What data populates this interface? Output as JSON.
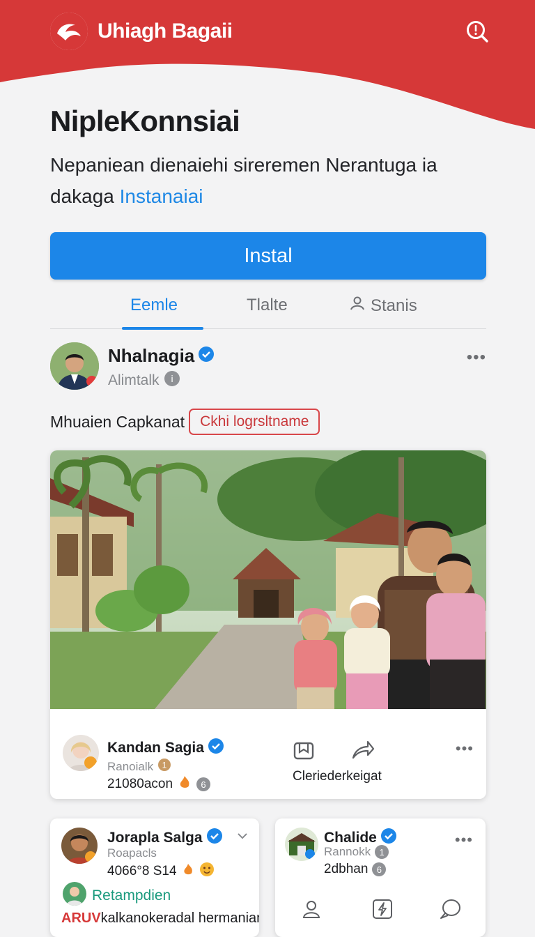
{
  "header": {
    "brand_name": "Uhiagh Bagaii",
    "brand_color": "#d63838",
    "search_icon": "search-icon"
  },
  "main": {
    "title": "NipleKonnsiai",
    "description": "Nepaniean dienaiehi sireremen Nerantuga ia dakaga",
    "description_link": "Instanaiai",
    "install_label": "Instal",
    "accent_color": "#1c86e8"
  },
  "tabs": [
    {
      "label": "Eemle",
      "active": true
    },
    {
      "label": "Tlalte",
      "active": false
    },
    {
      "label": "Stanis",
      "icon": "person-icon",
      "active": false
    }
  ],
  "post": {
    "author_name": "Nhalnagia",
    "author_sub": "Alimtalk",
    "more_label": "•••",
    "caption_text": "Mhuaien Capkanat",
    "caption_tag": "Ckhi logrsltname",
    "footer": {
      "name": "Kandan Sagia",
      "sub": "Ranoialk",
      "stat": "21080acon",
      "action_label": "Cleriederkeigat",
      "more_label": "•••"
    }
  },
  "cards": [
    {
      "name": "Jorapla Salga",
      "sub": "Roapacls",
      "stat": "4066°8 S14",
      "link": "Retampdien",
      "footer_prefix": "ARUV",
      "footer_text": "kalkanokeradal hermanian"
    },
    {
      "name": "Chalide",
      "sub": "Rannokk",
      "stat": "2dbhan",
      "more_label": "•••"
    }
  ]
}
